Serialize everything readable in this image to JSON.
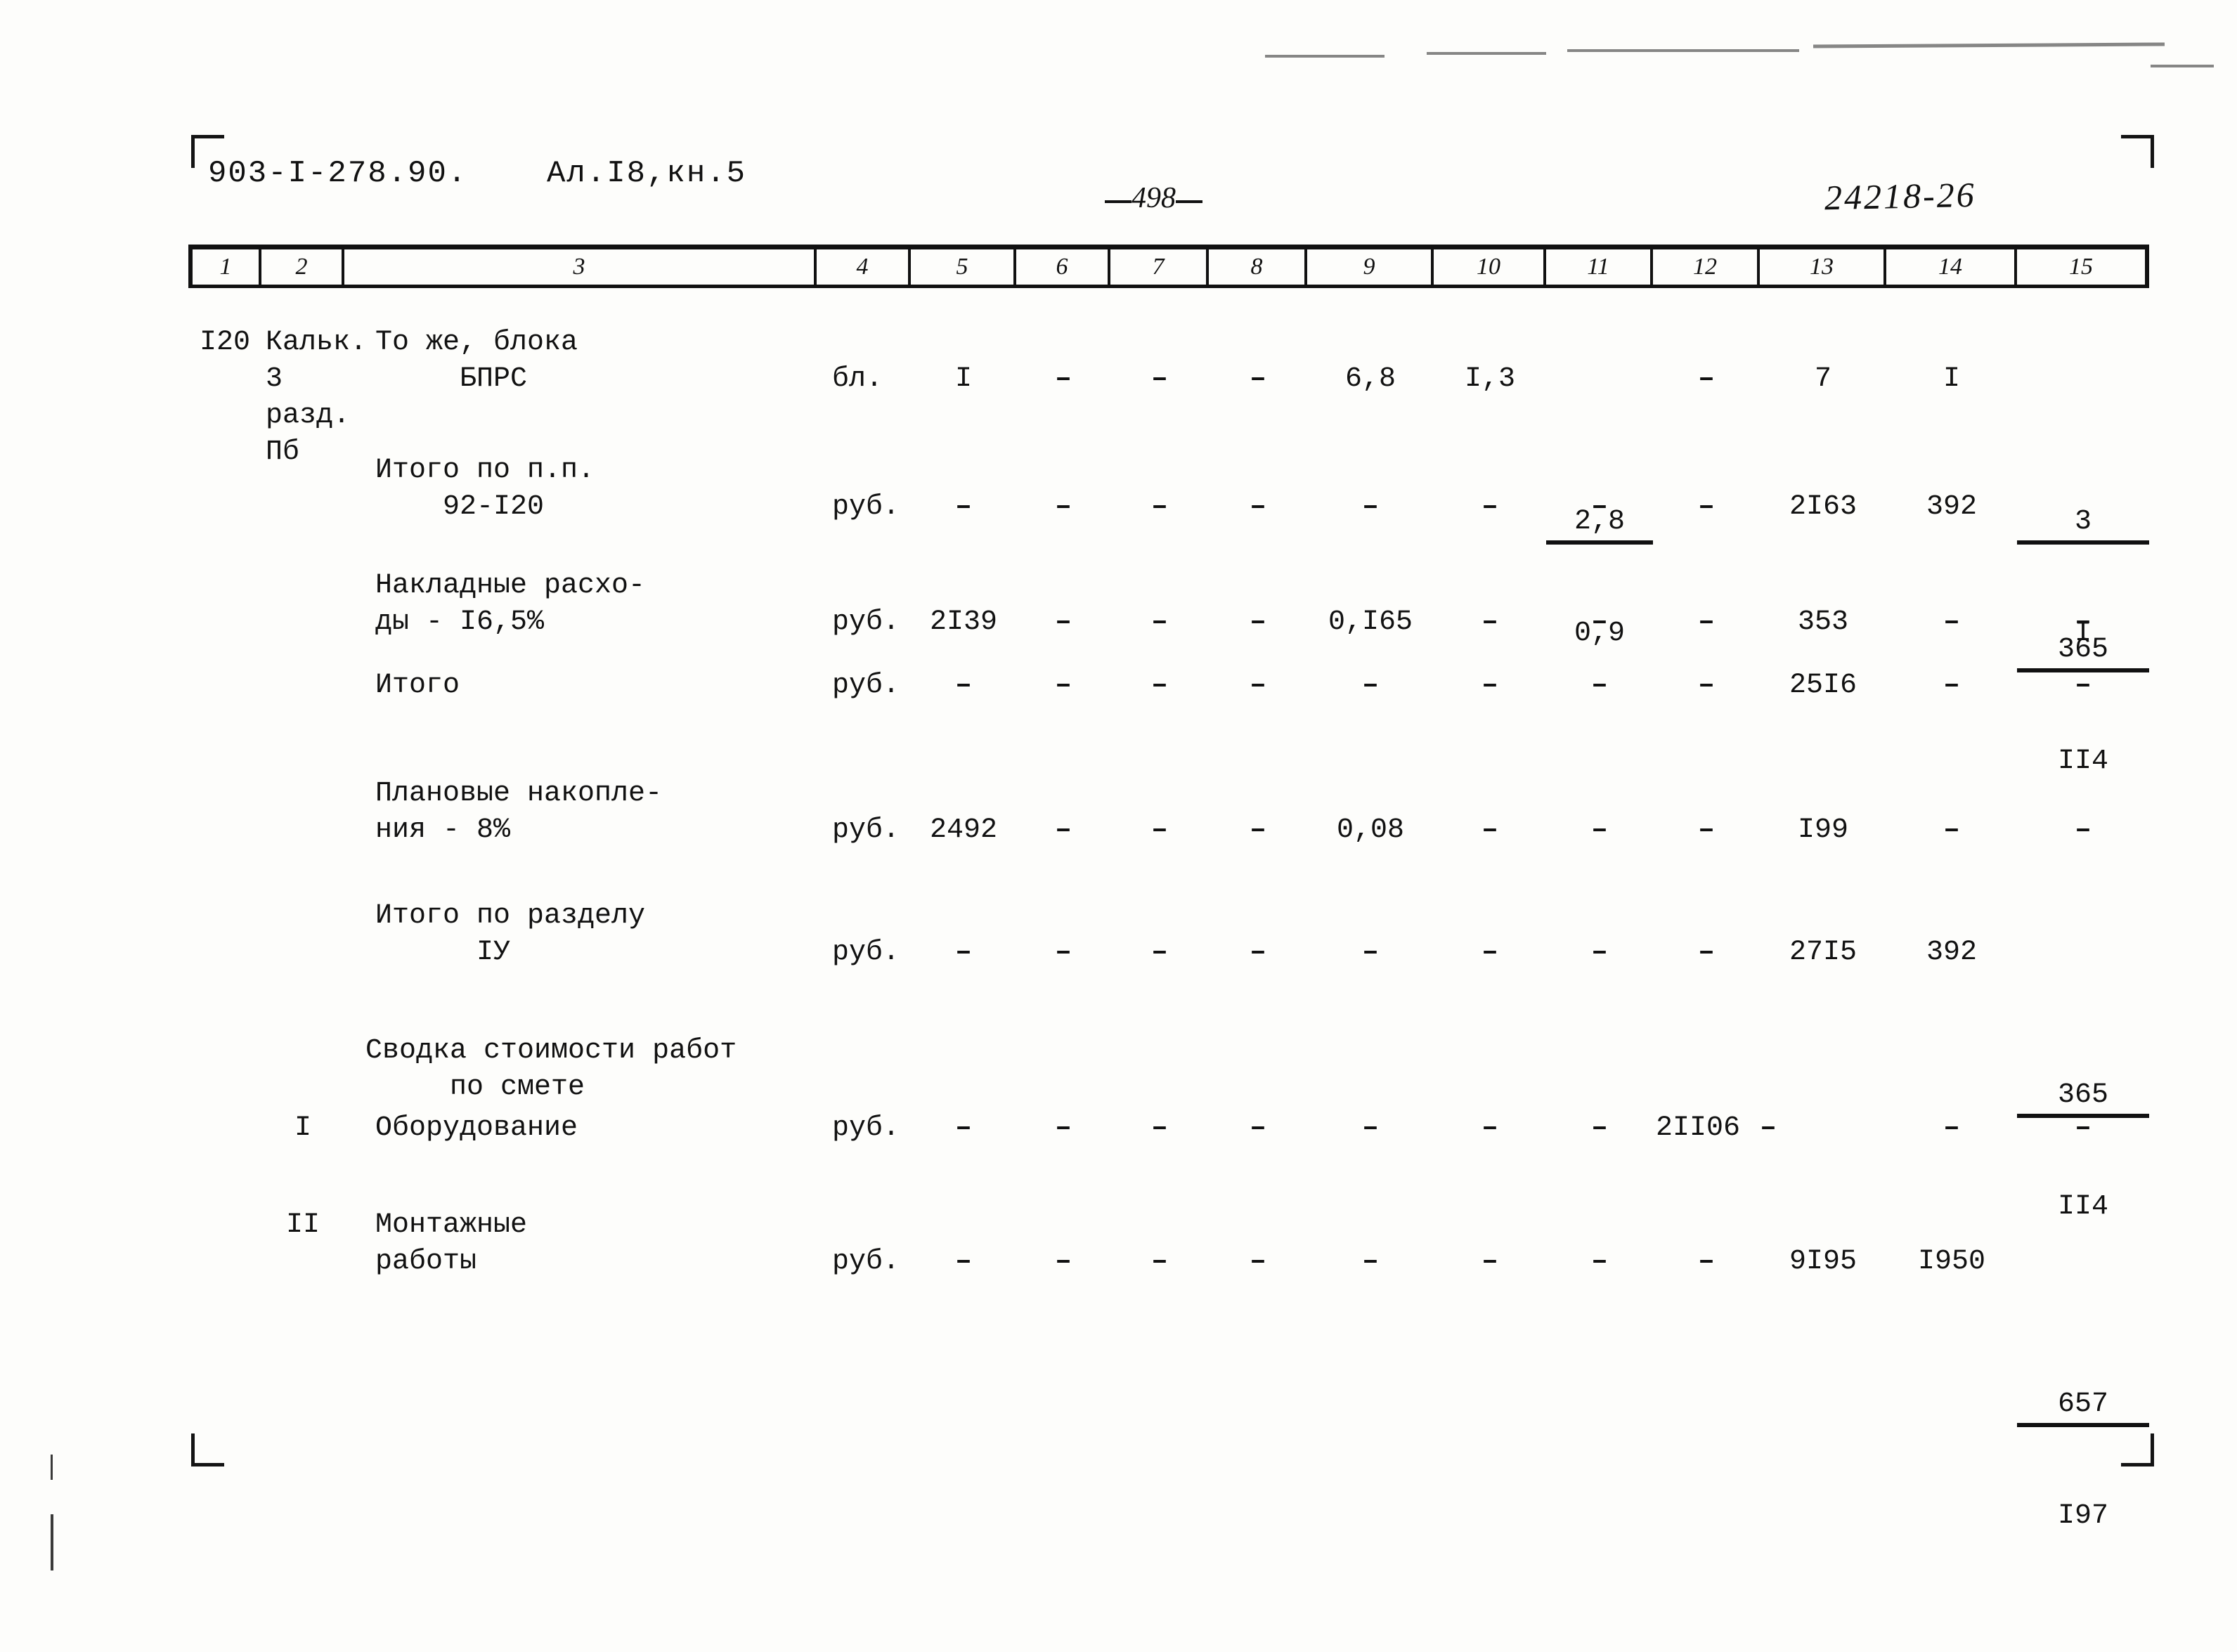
{
  "document": {
    "code": "903-I-278.90.",
    "album": "Ал.I8,кн.5",
    "page_number": "498",
    "archive_code": "24218-26"
  },
  "table": {
    "column_headers": [
      "1",
      "2",
      "3",
      "4",
      "5",
      "6",
      "7",
      "8",
      "9",
      "10",
      "11",
      "12",
      "13",
      "14",
      "15"
    ],
    "rows": [
      {
        "c1": "I20",
        "c2": "Кальк.\n3\nразд.\nПб",
        "c3": "То же, блока\n     БПРС",
        "c4": "бл.",
        "c5": "I",
        "c6": "–",
        "c7": "–",
        "c8": "–",
        "c9": "6,8",
        "c10": "I,3",
        "c11_top": "2,8",
        "c11_bot": "0,9",
        "c12": "–",
        "c13": "7",
        "c14": "I",
        "c15_top": "3",
        "c15_bot": "I"
      },
      {
        "c1": "",
        "c2": "",
        "c3": "Итого по п.п.\n    92-I20",
        "c4": "руб.",
        "c5": "–",
        "c6": "–",
        "c7": "–",
        "c8": "–",
        "c9": "–",
        "c10": "–",
        "c11": "–",
        "c12": "–",
        "c13": "2I63",
        "c14": "392",
        "c15_top": "365",
        "c15_bot": "II4"
      },
      {
        "c1": "",
        "c2": "",
        "c3": "Накладные расхо-\nды - I6,5%",
        "c4": "руб.",
        "c5": "2I39",
        "c6": "–",
        "c7": "–",
        "c8": "–",
        "c9": "0,I65",
        "c10": "–",
        "c11": "–",
        "c12": "–",
        "c13": "353",
        "c14": "–",
        "c15": "–"
      },
      {
        "c1": "",
        "c2": "",
        "c3": "Итого",
        "c4": "руб.",
        "c5": "–",
        "c6": "–",
        "c7": "–",
        "c8": "–",
        "c9": "–",
        "c10": "–",
        "c11": "–",
        "c12": "–",
        "c13": "25I6",
        "c14": "–",
        "c15": "–"
      },
      {
        "c1": "",
        "c2": "",
        "c3": "Плановые накопле-\nния - 8%",
        "c4": "руб.",
        "c5": "2492",
        "c6": "–",
        "c7": "–",
        "c8": "–",
        "c9": "0,08",
        "c10": "–",
        "c11": "–",
        "c12": "–",
        "c13": "I99",
        "c14": "–",
        "c15": "–"
      },
      {
        "c1": "",
        "c2": "",
        "c3": "Итого по разделу\n      IУ",
        "c4": "руб.",
        "c5": "–",
        "c6": "–",
        "c7": "–",
        "c8": "–",
        "c9": "–",
        "c10": "–",
        "c11": "–",
        "c12": "–",
        "c13": "27I5",
        "c14": "392",
        "c15_top": "365",
        "c15_bot": "II4"
      }
    ],
    "summary_heading": "Сводка стоимости работ\n     по смете",
    "summary_rows": [
      {
        "c1": "",
        "c2": "I",
        "c3": "Оборудование",
        "c4": "руб.",
        "c5": "–",
        "c6": "–",
        "c7": "–",
        "c8": "–",
        "c9": "–",
        "c10": "–",
        "c11": "–",
        "c12": "2II06",
        "c13": "–",
        "c14": "–",
        "c15": "–"
      },
      {
        "c1": "",
        "c2": "II",
        "c3": "Монтажные\nработы",
        "c4": "руб.",
        "c5": "–",
        "c6": "–",
        "c7": "–",
        "c8": "–",
        "c9": "–",
        "c10": "–",
        "c11": "–",
        "c12": "–",
        "c13": "9I95",
        "c14": "I950",
        "c15_top": "657",
        "c15_bot": "I97"
      }
    ]
  }
}
